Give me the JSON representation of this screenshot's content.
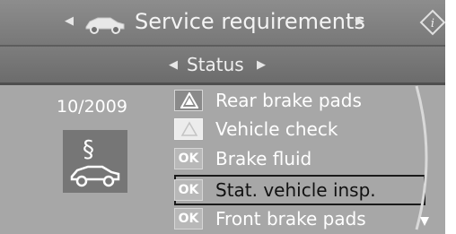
{
  "header": {
    "title": "Service requirements",
    "car_icon": "car-icon",
    "info_icon": "info-icon"
  },
  "subheader": {
    "title": "Status"
  },
  "left_panel": {
    "date": "10/2009",
    "tile_icon": "service-paragraph-car-icon"
  },
  "list": {
    "items": [
      {
        "badge_type": "warning-triangle",
        "badge_text": "",
        "label": "Rear brake pads"
      },
      {
        "badge_type": "warning-triangle-light",
        "badge_text": "",
        "label": "Vehicle check"
      },
      {
        "badge_type": "ok",
        "badge_text": "OK",
        "label": "Brake fluid"
      },
      {
        "badge_type": "ok",
        "badge_text": "OK",
        "label": "Stat. vehicle insp."
      },
      {
        "badge_type": "ok",
        "badge_text": "OK",
        "label": "Front brake pads"
      }
    ],
    "selected_index": 3
  },
  "colors": {
    "screen_bg": "#a7a7a7",
    "header_bg": "#808080",
    "selected_border": "#1a1a1a"
  }
}
